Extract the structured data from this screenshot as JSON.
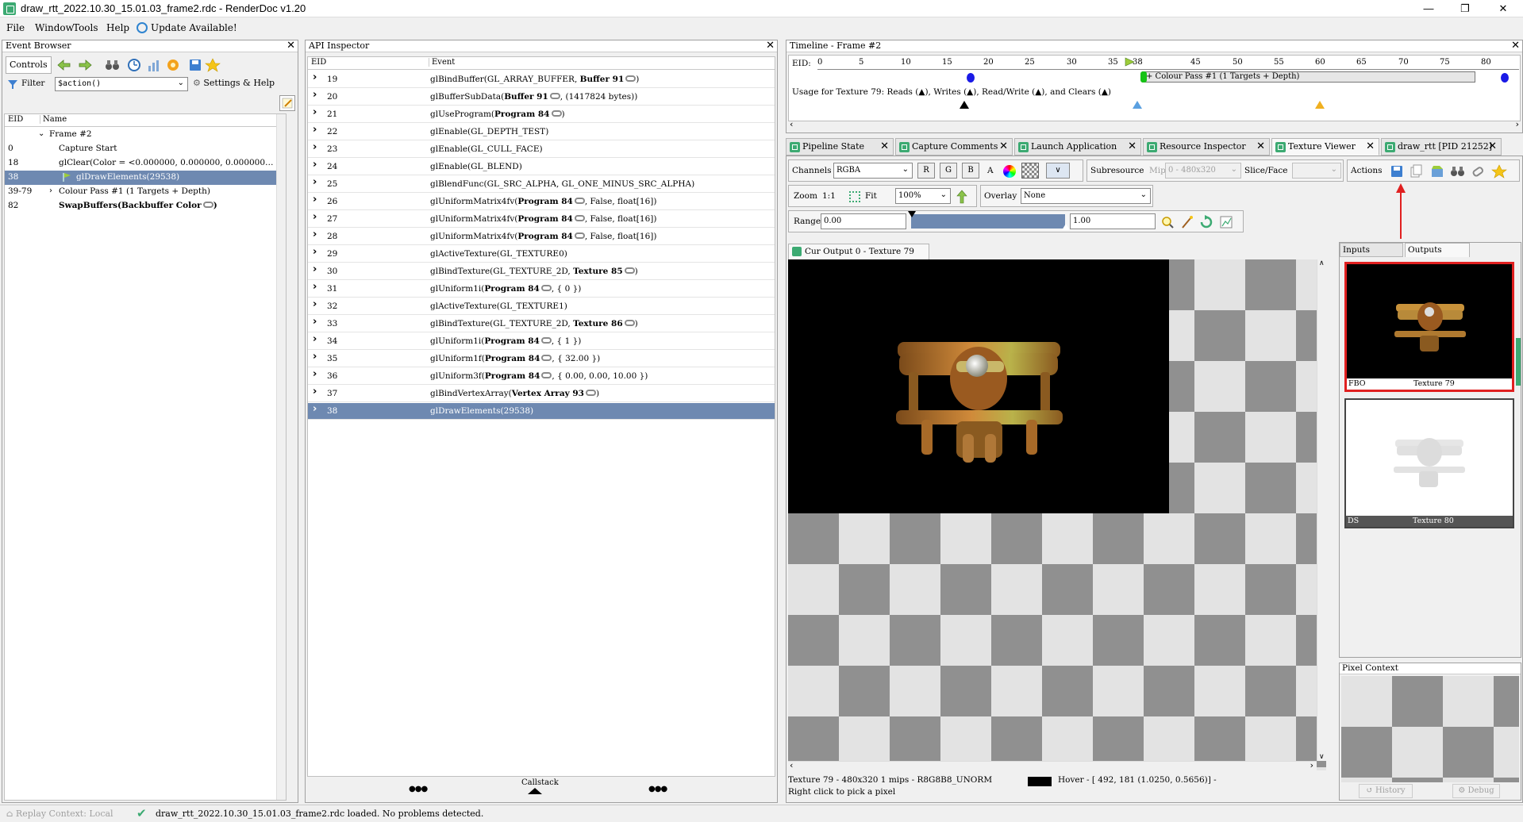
{
  "window": {
    "title": "draw_rtt_2022.10.30_15.01.03_frame2.rdc - RenderDoc v1.20",
    "minimize": "—",
    "maximize": "❐",
    "close": "✕"
  },
  "menu": {
    "items": [
      "File",
      "Window",
      "Tools",
      "Help"
    ],
    "update": "Update Available!"
  },
  "event_browser": {
    "title": "Event Browser",
    "controls_label": "Controls",
    "filter_label": "Filter",
    "filter_value": "$action()",
    "settings_label": "Settings & Help",
    "col_eid": "EID",
    "col_name": "Name",
    "rows": [
      {
        "eid": "",
        "name": "Frame #2"
      },
      {
        "eid": "0",
        "name": "Capture Start"
      },
      {
        "eid": "18",
        "name": "glClear(Color = <0.000000, 0.000000, 0.000000…"
      },
      {
        "eid": "38",
        "name": "glDrawElements(29538)"
      },
      {
        "eid": "39-79",
        "name": "Colour Pass #1 (1 Targets + Depth)"
      },
      {
        "eid": "82",
        "name": "SwapBuffers(Backbuffer Color"
      }
    ]
  },
  "api_inspector": {
    "title": "API Inspector",
    "col_eid": "EID",
    "col_event": "Event",
    "callstack": "Callstack",
    "dots": "●●●",
    "rows": [
      {
        "eid": "19",
        "pre": "glBindBuffer(GL_ARRAY_BUFFER, ",
        "bold": "Buffer 91",
        "link": true,
        "post": ")"
      },
      {
        "eid": "20",
        "pre": "glBufferSubData(",
        "bold": "Buffer 91",
        "link": true,
        "post": ",  (1417824  bytes))"
      },
      {
        "eid": "21",
        "pre": "glUseProgram(",
        "bold": "Program 84",
        "link": true,
        "post": ")"
      },
      {
        "eid": "22",
        "pre": "glEnable(GL_DEPTH_TEST)",
        "bold": "",
        "link": false,
        "post": ""
      },
      {
        "eid": "23",
        "pre": "glEnable(GL_CULL_FACE)",
        "bold": "",
        "link": false,
        "post": ""
      },
      {
        "eid": "24",
        "pre": "glEnable(GL_BLEND)",
        "bold": "",
        "link": false,
        "post": ""
      },
      {
        "eid": "25",
        "pre": "glBlendFunc(GL_SRC_ALPHA, GL_ONE_MINUS_SRC_ALPHA)",
        "bold": "",
        "link": false,
        "post": ""
      },
      {
        "eid": "26",
        "pre": "glUniformMatrix4fv(",
        "bold": "Program 84",
        "link": true,
        "post": ",  False,  float[16])"
      },
      {
        "eid": "27",
        "pre": "glUniformMatrix4fv(",
        "bold": "Program 84",
        "link": true,
        "post": ",  False,  float[16])"
      },
      {
        "eid": "28",
        "pre": "glUniformMatrix4fv(",
        "bold": "Program 84",
        "link": true,
        "post": ",  False,  float[16])"
      },
      {
        "eid": "29",
        "pre": "glActiveTexture(GL_TEXTURE0)",
        "bold": "",
        "link": false,
        "post": ""
      },
      {
        "eid": "30",
        "pre": "glBindTexture(GL_TEXTURE_2D, ",
        "bold": "Texture 85",
        "link": true,
        "post": ")"
      },
      {
        "eid": "31",
        "pre": "glUniform1i(",
        "bold": "Program 84",
        "link": true,
        "post": ",  { 0 })"
      },
      {
        "eid": "32",
        "pre": "glActiveTexture(GL_TEXTURE1)",
        "bold": "",
        "link": false,
        "post": ""
      },
      {
        "eid": "33",
        "pre": "glBindTexture(GL_TEXTURE_2D, ",
        "bold": "Texture 86",
        "link": true,
        "post": ")"
      },
      {
        "eid": "34",
        "pre": "glUniform1i(",
        "bold": "Program 84",
        "link": true,
        "post": ",  { 1 })"
      },
      {
        "eid": "35",
        "pre": "glUniform1f(",
        "bold": "Program 84",
        "link": true,
        "post": ",  { 32.00 })"
      },
      {
        "eid": "36",
        "pre": "glUniform3f(",
        "bold": "Program 84",
        "link": true,
        "post": ",  { 0.00,  0.00,  10.00 })"
      },
      {
        "eid": "37",
        "pre": "glBindVertexArray(",
        "bold": "Vertex Array 93",
        "link": true,
        "post": ")"
      },
      {
        "eid": "38",
        "pre": "glDrawElements(29538)",
        "bold": "",
        "link": false,
        "post": ""
      }
    ]
  },
  "timeline": {
    "title": "Timeline - Frame #2",
    "eid_label": "EID:",
    "ticks": [
      "0",
      "5",
      "10",
      "15",
      "20",
      "25",
      "30",
      "35",
      "38",
      "45",
      "50",
      "55",
      "60",
      "65",
      "70",
      "75",
      "80"
    ],
    "pass_label": "+ Colour Pass #1 (1 Targets + Depth)",
    "usage_text": "Usage for Texture 79: Reads (▲), Writes (▲), Read/Write (▲), and Clears (▲)"
  },
  "tabs": [
    {
      "label": "Pipeline State",
      "active": false
    },
    {
      "label": "Capture Comments",
      "active": false
    },
    {
      "label": "Launch Application",
      "active": false
    },
    {
      "label": "Resource Inspector",
      "active": false
    },
    {
      "label": "Texture Viewer",
      "active": true
    },
    {
      "label": "draw_rtt [PID 21252]",
      "active": false
    }
  ],
  "texture_viewer": {
    "channels_label": "Channels",
    "channels_value": "RGBA",
    "chan_r": "R",
    "chan_g": "G",
    "chan_b": "B",
    "chan_a": "A",
    "subresource_label": "Subresource",
    "mip_label": "Mip",
    "mip_value": "0 - 480x320",
    "slice_label": "Slice/Face",
    "actions_label": "Actions",
    "zoom_label": "Zoom",
    "zoom_11": "1:1",
    "fit_label": "Fit",
    "zoom_value": "100%",
    "overlay_label": "Overlay",
    "overlay_value": "None",
    "range_label": "Range",
    "range_min": "0.00",
    "range_max": "1.00",
    "viewer_tab": "Cur Output 0 - Texture 79",
    "status_line1": "Texture 79 - 480x320 1 mips - R8G8B8_UNORM",
    "status_hover": "Hover - [ 492,  181 (1.0250, 0.5656)] -",
    "status_line2": "Right click to pick a pixel",
    "inputs_tab": "Inputs",
    "outputs_tab": "Outputs",
    "thumb1_left": "FBO",
    "thumb1_right": "Texture 79",
    "thumb2_left": "DS",
    "thumb2_right": "Texture 80",
    "pixel_context": "Pixel Context",
    "history": "History",
    "debug": "Debug"
  },
  "statusbar": {
    "replay": "Replay Context: Local",
    "message": "draw_rtt_2022.10.30_15.01.03_frame2.rdc loaded. No problems detected."
  },
  "colors": {
    "selection": "#6e89b1",
    "accent_green": "#3caa72",
    "highlight_red": "#e02020"
  }
}
